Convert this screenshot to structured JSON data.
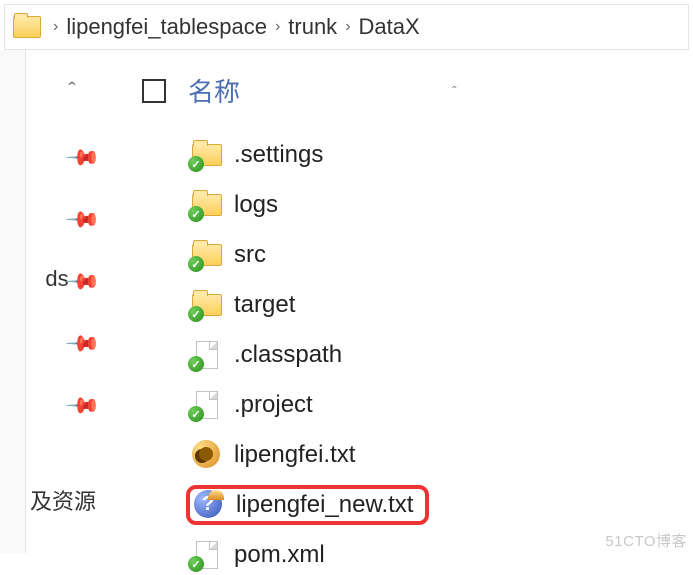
{
  "breadcrumb": {
    "items": [
      "lipengfei_tablespace",
      "trunk",
      "DataX"
    ],
    "sep": "›"
  },
  "sidebar": {
    "labels": [
      "ds",
      "及资源"
    ]
  },
  "header": {
    "name_col": "名称",
    "sort_glyph": "ˆ"
  },
  "files": [
    {
      "name": ".settings"
    },
    {
      "name": "logs"
    },
    {
      "name": "src"
    },
    {
      "name": "target"
    },
    {
      "name": ".classpath"
    },
    {
      "name": ".project"
    },
    {
      "name": "lipengfei.txt"
    },
    {
      "name": "lipengfei_new.txt"
    },
    {
      "name": "pom.xml"
    }
  ],
  "watermark": "51CTO博客"
}
